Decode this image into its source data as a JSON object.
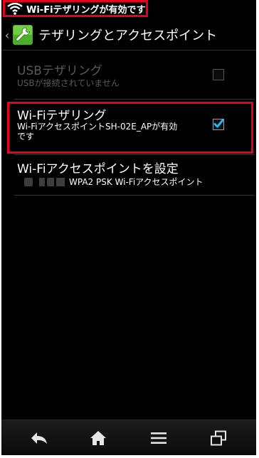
{
  "status_bar": {
    "notification_text": "Wi-Fiテザリングが有効です",
    "icon": "wifi-tethering-icon"
  },
  "action_bar": {
    "title": "テザリングとアクセスポイント",
    "back_icon": "chevron-left-icon",
    "app_icon": "wrench-icon"
  },
  "settings": [
    {
      "title": "USBテザリング",
      "summary": "USBが接続されていません",
      "checked": false,
      "enabled": false
    },
    {
      "title": "Wi-Fiテザリング",
      "summary_line1": "Wi-FiアクセスポイントSH-02E_APが有効",
      "summary_line2": "です",
      "checked": true,
      "enabled": true
    },
    {
      "title": "Wi-Fiアクセスポイントを設定",
      "summary": "WPA2 PSK Wi-Fiアクセスポイント"
    }
  ],
  "nav_bar": {
    "icons": [
      "back-icon",
      "home-icon",
      "menu-icon",
      "recent-apps-icon"
    ]
  },
  "colors": {
    "highlight": "#e8001c",
    "check_accent": "#29b6f6",
    "disabled_text": "#5a5a5a",
    "background": "#000000"
  }
}
